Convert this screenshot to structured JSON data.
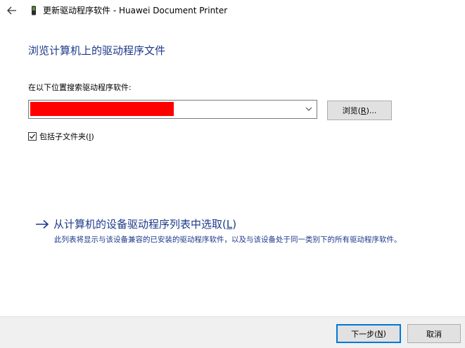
{
  "titlebar": {
    "title": "更新驱动程序软件 - Huawei Document Printer",
    "back_icon": "back-arrow-icon",
    "device_icon": "device-icon"
  },
  "main": {
    "heading": "浏览计算机上的驱动程序文件",
    "search_label": "在以下位置搜索驱动程序软件:",
    "path_value": "",
    "path_redacted_color": "#ff0000",
    "browse_label_pre": "浏览(",
    "browse_label_key": "R",
    "browse_label_post": ")...",
    "include_subfolders_pre": "包括子文件夹(",
    "include_subfolders_key": "I",
    "include_subfolders_post": ")",
    "include_subfolders_checked": true
  },
  "pick_option": {
    "link_pre": "从计算机的设备驱动程序列表中选取(",
    "link_key": "L",
    "link_post": ")",
    "description": "此列表将显示与该设备兼容的已安装的驱动程序软件，以及与该设备处于同一类别下的所有驱动程序软件。"
  },
  "footer": {
    "next_pre": "下一步(",
    "next_key": "N",
    "next_post": ")",
    "cancel_label": "取消"
  },
  "colors": {
    "accent": "#0078d7",
    "link": "#1c3a8a",
    "footer_bg": "#f0f0f0"
  }
}
